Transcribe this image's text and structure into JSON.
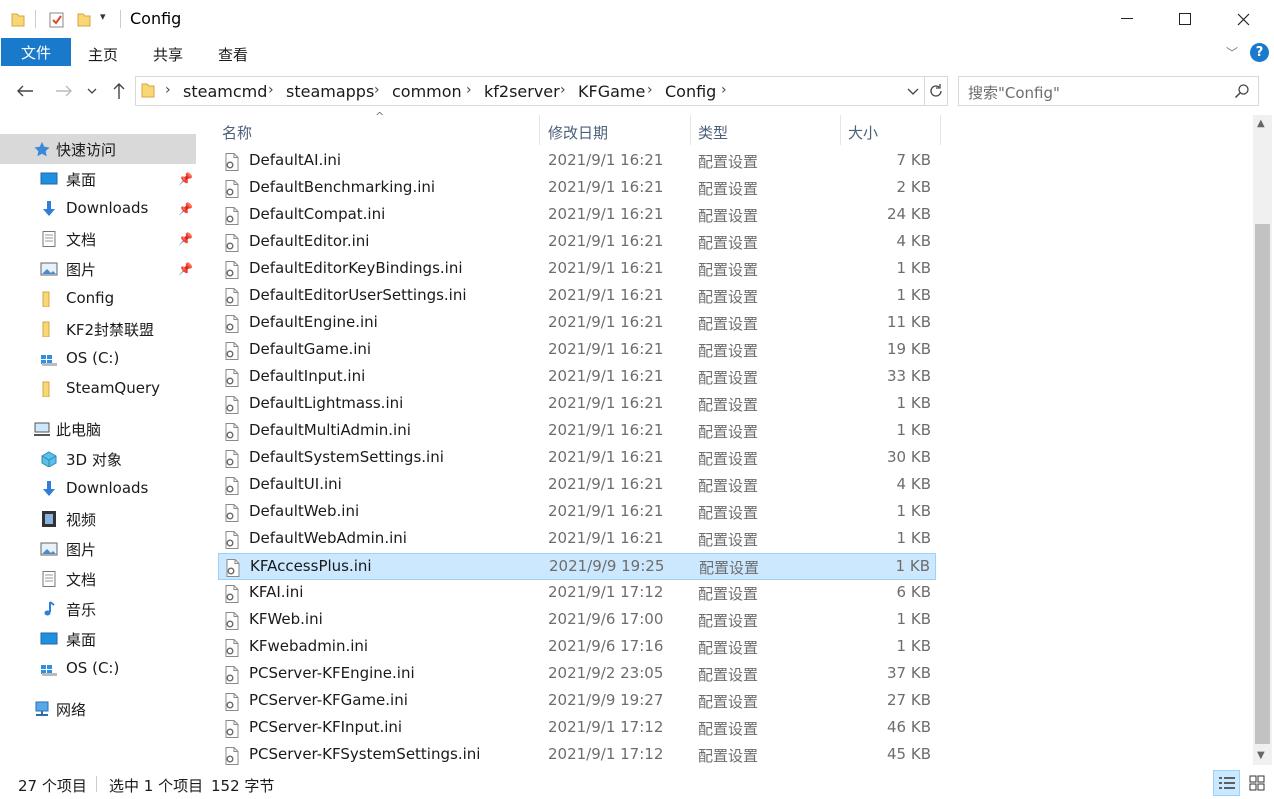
{
  "window": {
    "title": "Config",
    "colors": {
      "accent": "#1979ca",
      "selection": "#cce8ff",
      "selection_border": "#99d1ff",
      "header_text": "#4c607a"
    }
  },
  "ribbon": {
    "file_tab": "文件",
    "tabs": [
      "主页",
      "共享",
      "查看"
    ]
  },
  "address": {
    "crumbs": [
      "steamcmd",
      "steamapps",
      "common",
      "kf2server",
      "KFGame",
      "Config"
    ]
  },
  "search": {
    "placeholder": "搜索\"Config\""
  },
  "sidebar": {
    "quick_access": {
      "label": "快速访问",
      "icon": "star-icon"
    },
    "quick_items": [
      {
        "label": "桌面",
        "icon": "desktop-icon",
        "pinned": true
      },
      {
        "label": "Downloads",
        "icon": "download-icon",
        "pinned": true
      },
      {
        "label": "文档",
        "icon": "document-icon",
        "pinned": true
      },
      {
        "label": "图片",
        "icon": "pictures-icon",
        "pinned": true
      },
      {
        "label": "Config",
        "icon": "folder-icon",
        "pinned": false
      },
      {
        "label": "KF2封禁联盟",
        "icon": "folder-icon",
        "pinned": false
      },
      {
        "label": "OS (C:)",
        "icon": "drive-icon",
        "pinned": false
      },
      {
        "label": "SteamQuery",
        "icon": "folder-icon",
        "pinned": false
      }
    ],
    "this_pc": {
      "label": "此电脑",
      "icon": "computer-icon"
    },
    "pc_items": [
      {
        "label": "3D 对象",
        "icon": "3d-objects-icon"
      },
      {
        "label": "Downloads",
        "icon": "download-icon"
      },
      {
        "label": "视频",
        "icon": "video-icon"
      },
      {
        "label": "图片",
        "icon": "pictures-icon"
      },
      {
        "label": "文档",
        "icon": "document-icon"
      },
      {
        "label": "音乐",
        "icon": "music-icon"
      },
      {
        "label": "桌面",
        "icon": "desktop-icon"
      },
      {
        "label": "OS (C:)",
        "icon": "drive-icon"
      }
    ],
    "network": {
      "label": "网络",
      "icon": "network-icon"
    }
  },
  "columns": {
    "name": "名称",
    "date": "修改日期",
    "type": "类型",
    "size": "大小"
  },
  "files": [
    {
      "name": "DefaultAI.ini",
      "date": "2021/9/1 16:21",
      "type": "配置设置",
      "size": "7 KB"
    },
    {
      "name": "DefaultBenchmarking.ini",
      "date": "2021/9/1 16:21",
      "type": "配置设置",
      "size": "2 KB"
    },
    {
      "name": "DefaultCompat.ini",
      "date": "2021/9/1 16:21",
      "type": "配置设置",
      "size": "24 KB"
    },
    {
      "name": "DefaultEditor.ini",
      "date": "2021/9/1 16:21",
      "type": "配置设置",
      "size": "4 KB"
    },
    {
      "name": "DefaultEditorKeyBindings.ini",
      "date": "2021/9/1 16:21",
      "type": "配置设置",
      "size": "1 KB"
    },
    {
      "name": "DefaultEditorUserSettings.ini",
      "date": "2021/9/1 16:21",
      "type": "配置设置",
      "size": "1 KB"
    },
    {
      "name": "DefaultEngine.ini",
      "date": "2021/9/1 16:21",
      "type": "配置设置",
      "size": "11 KB"
    },
    {
      "name": "DefaultGame.ini",
      "date": "2021/9/1 16:21",
      "type": "配置设置",
      "size": "19 KB"
    },
    {
      "name": "DefaultInput.ini",
      "date": "2021/9/1 16:21",
      "type": "配置设置",
      "size": "33 KB"
    },
    {
      "name": "DefaultLightmass.ini",
      "date": "2021/9/1 16:21",
      "type": "配置设置",
      "size": "1 KB"
    },
    {
      "name": "DefaultMultiAdmin.ini",
      "date": "2021/9/1 16:21",
      "type": "配置设置",
      "size": "1 KB"
    },
    {
      "name": "DefaultSystemSettings.ini",
      "date": "2021/9/1 16:21",
      "type": "配置设置",
      "size": "30 KB"
    },
    {
      "name": "DefaultUI.ini",
      "date": "2021/9/1 16:21",
      "type": "配置设置",
      "size": "4 KB"
    },
    {
      "name": "DefaultWeb.ini",
      "date": "2021/9/1 16:21",
      "type": "配置设置",
      "size": "1 KB"
    },
    {
      "name": "DefaultWebAdmin.ini",
      "date": "2021/9/1 16:21",
      "type": "配置设置",
      "size": "1 KB"
    },
    {
      "name": "KFAccessPlus.ini",
      "date": "2021/9/9 19:25",
      "type": "配置设置",
      "size": "1 KB",
      "selected": true
    },
    {
      "name": "KFAI.ini",
      "date": "2021/9/1 17:12",
      "type": "配置设置",
      "size": "6 KB"
    },
    {
      "name": "KFWeb.ini",
      "date": "2021/9/6 17:00",
      "type": "配置设置",
      "size": "1 KB"
    },
    {
      "name": "KFwebadmin.ini",
      "date": "2021/9/6 17:16",
      "type": "配置设置",
      "size": "1 KB"
    },
    {
      "name": "PCServer-KFEngine.ini",
      "date": "2021/9/2 23:05",
      "type": "配置设置",
      "size": "37 KB"
    },
    {
      "name": "PCServer-KFGame.ini",
      "date": "2021/9/9 19:27",
      "type": "配置设置",
      "size": "27 KB"
    },
    {
      "name": "PCServer-KFInput.ini",
      "date": "2021/9/1 17:12",
      "type": "配置设置",
      "size": "46 KB"
    },
    {
      "name": "PCServer-KFSystemSettings.ini",
      "date": "2021/9/1 17:12",
      "type": "配置设置",
      "size": "45 KB"
    }
  ],
  "status": {
    "count": "27 个项目",
    "selected": "选中 1 个项目",
    "size": "152 字节"
  }
}
